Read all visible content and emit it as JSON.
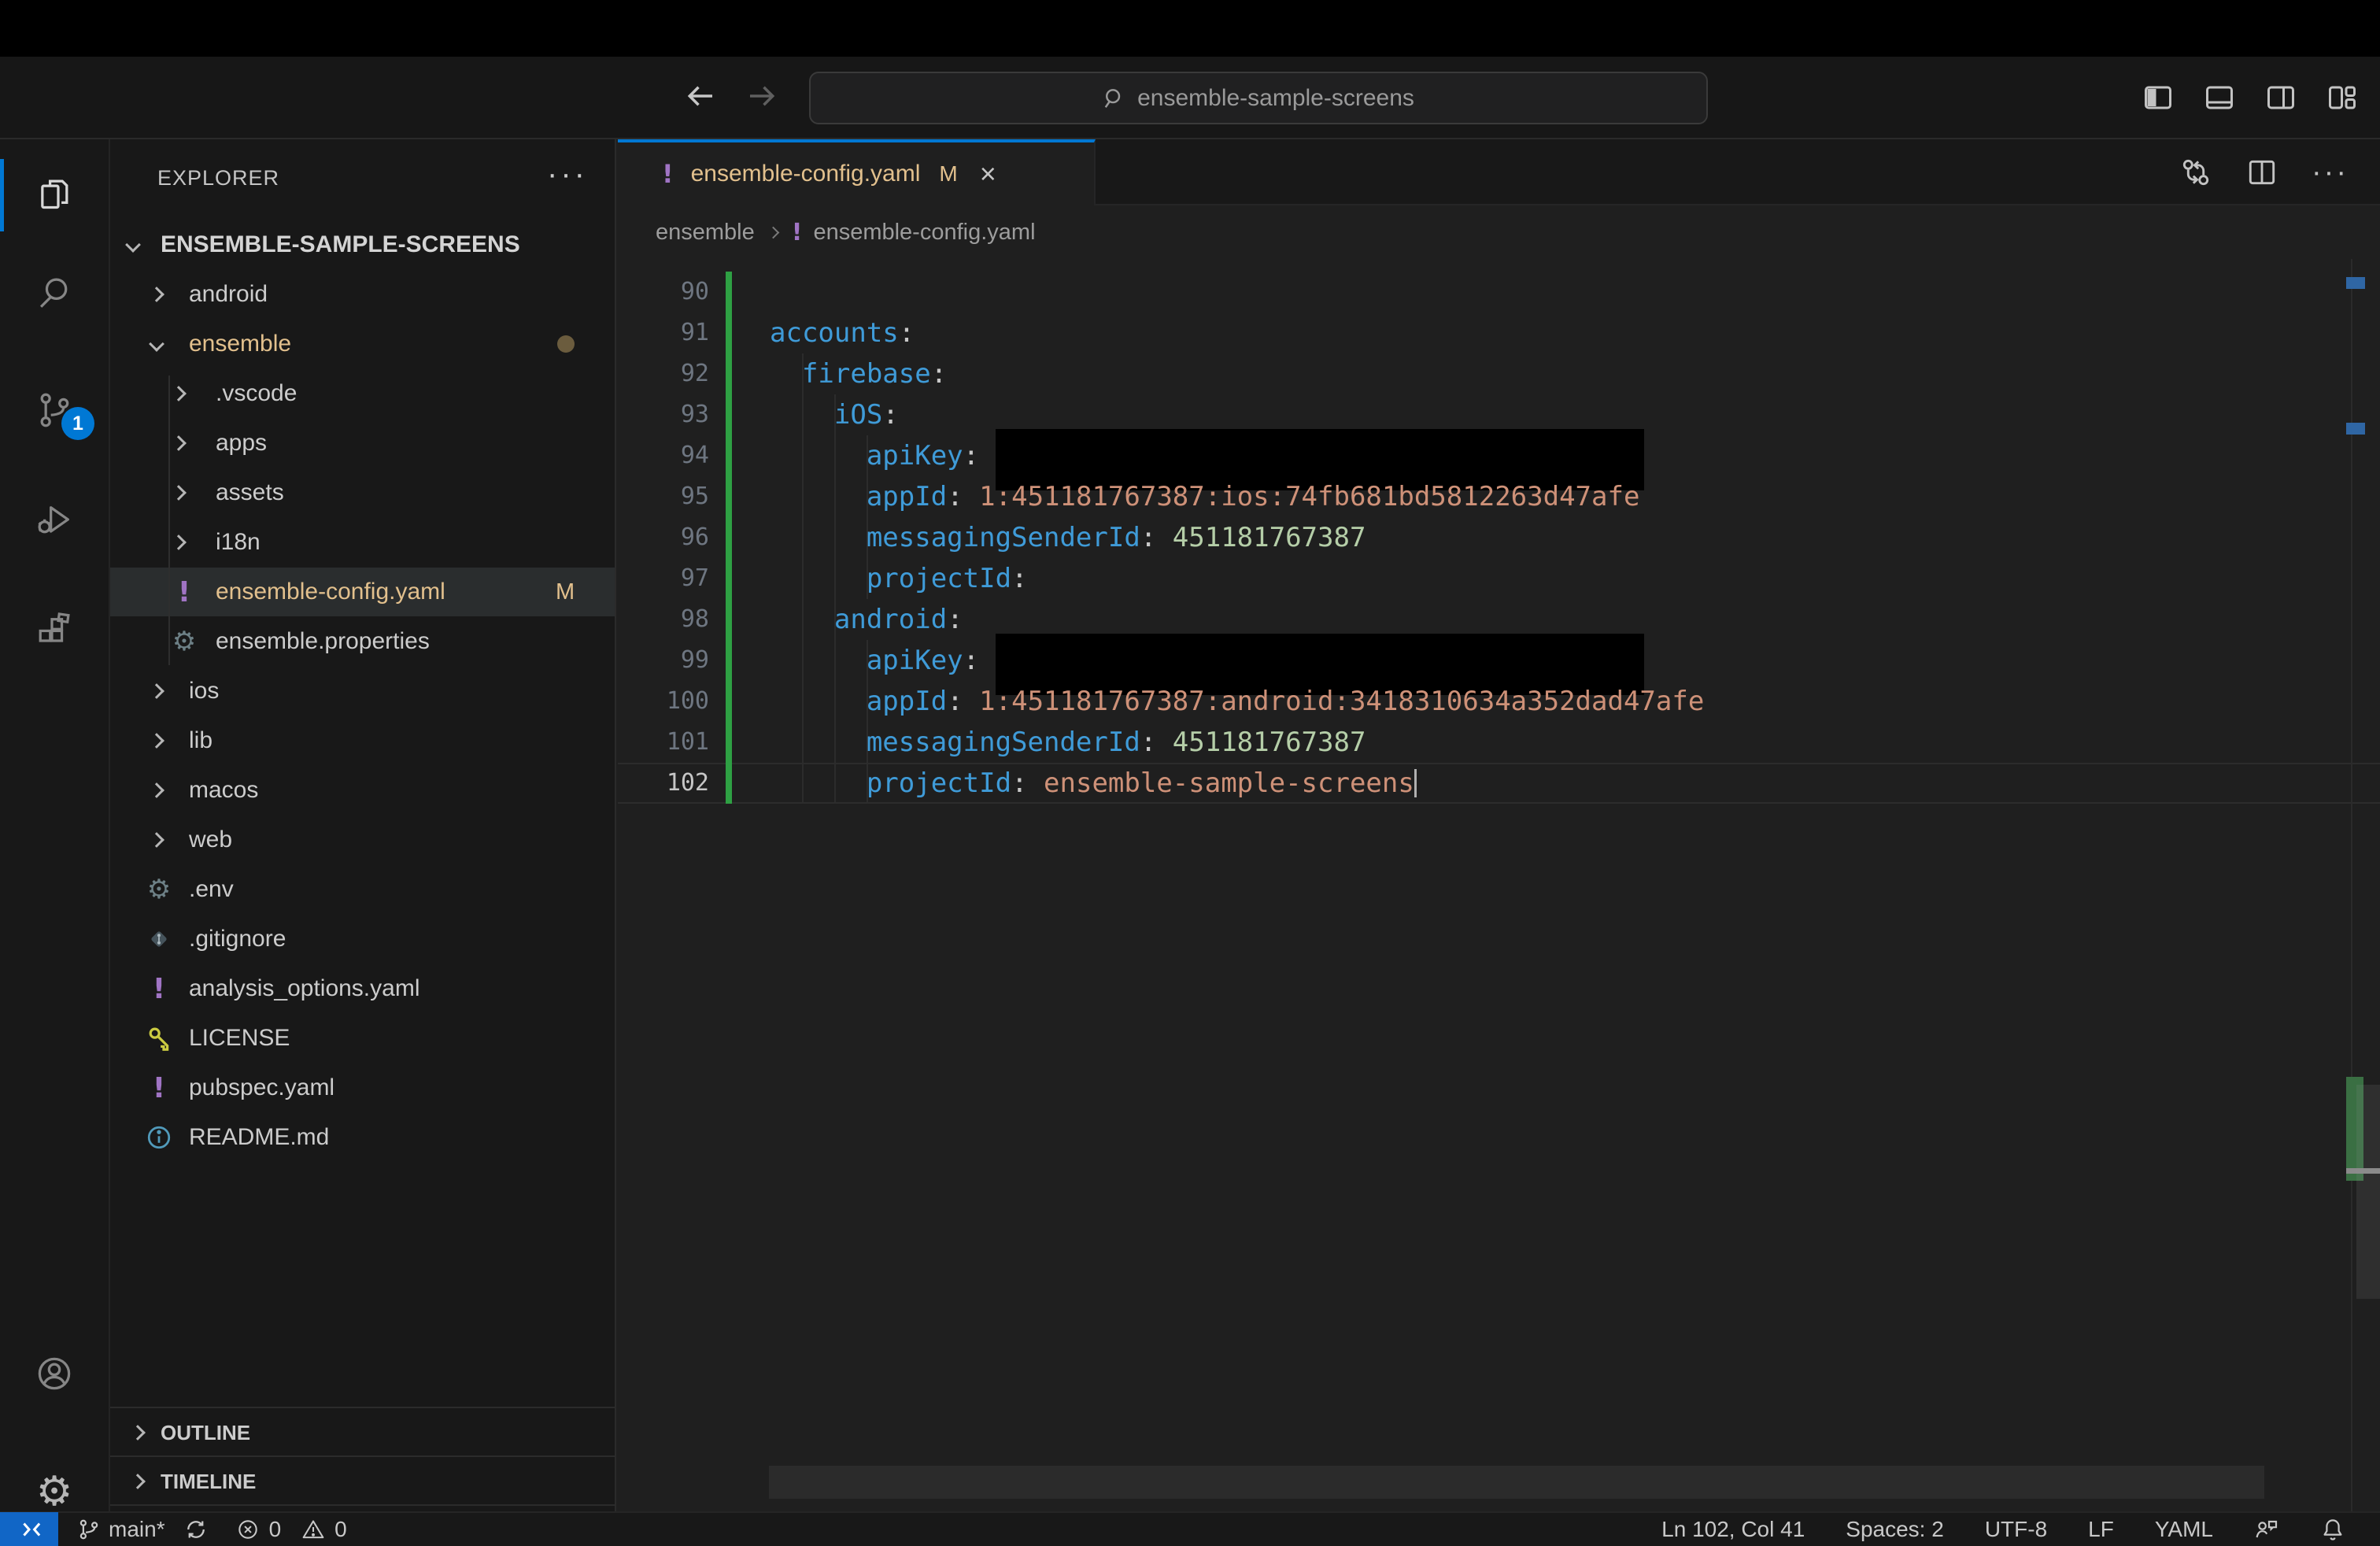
{
  "titlebar": {
    "search_text": "ensemble-sample-screens"
  },
  "activity_bar": {
    "scm_badge": "1"
  },
  "explorer": {
    "title": "EXPLORER",
    "root_label": "ENSEMBLE-SAMPLE-SCREENS",
    "items": [
      {
        "label": "android",
        "level": 1,
        "kind": "folder",
        "expanded": false
      },
      {
        "label": "ensemble",
        "level": 1,
        "kind": "folder",
        "expanded": true,
        "modified": true,
        "dot": true
      },
      {
        "label": ".vscode",
        "level": 2,
        "kind": "folder",
        "expanded": false
      },
      {
        "label": "apps",
        "level": 2,
        "kind": "folder",
        "expanded": false
      },
      {
        "label": "assets",
        "level": 2,
        "kind": "folder",
        "expanded": false
      },
      {
        "label": "i18n",
        "level": 2,
        "kind": "folder",
        "expanded": false
      },
      {
        "label": "ensemble-config.yaml",
        "level": 2,
        "kind": "file",
        "icon": "yaml",
        "modified": true,
        "selected": true,
        "badge": "M"
      },
      {
        "label": "ensemble.properties",
        "level": 2,
        "kind": "file",
        "icon": "gear"
      },
      {
        "label": "ios",
        "level": 1,
        "kind": "folder",
        "expanded": false
      },
      {
        "label": "lib",
        "level": 1,
        "kind": "folder",
        "expanded": false
      },
      {
        "label": "macos",
        "level": 1,
        "kind": "folder",
        "expanded": false
      },
      {
        "label": "web",
        "level": 1,
        "kind": "folder",
        "expanded": false
      },
      {
        "label": ".env",
        "level": 1,
        "kind": "file",
        "icon": "gear"
      },
      {
        "label": ".gitignore",
        "level": 1,
        "kind": "file",
        "icon": "git"
      },
      {
        "label": "analysis_options.yaml",
        "level": 1,
        "kind": "file",
        "icon": "yaml"
      },
      {
        "label": "LICENSE",
        "level": 1,
        "kind": "file",
        "icon": "key"
      },
      {
        "label": "pubspec.yaml",
        "level": 1,
        "kind": "file",
        "icon": "yaml"
      },
      {
        "label": "README.md",
        "level": 1,
        "kind": "file",
        "icon": "info"
      }
    ],
    "sections": {
      "outline": "OUTLINE",
      "timeline": "TIMELINE"
    }
  },
  "tabs": {
    "active": {
      "label": "ensemble-config.yaml",
      "badge": "M"
    }
  },
  "breadcrumbs": [
    {
      "label": "ensemble",
      "icon": null
    },
    {
      "label": "ensemble-config.yaml",
      "icon": "yaml"
    }
  ],
  "editor": {
    "lines": [
      {
        "n": "90",
        "segs": [],
        "mod": true
      },
      {
        "n": "91",
        "segs": [
          [
            "k",
            "accounts"
          ],
          [
            "p",
            ":"
          ]
        ],
        "mod": true
      },
      {
        "n": "92",
        "segs": [
          [
            "w",
            "  "
          ],
          [
            "k",
            "firebase"
          ],
          [
            "p",
            ":"
          ]
        ],
        "mod": true
      },
      {
        "n": "93",
        "segs": [
          [
            "w",
            "    "
          ],
          [
            "k",
            "iOS"
          ],
          [
            "p",
            ":"
          ]
        ],
        "mod": true
      },
      {
        "n": "94",
        "segs": [
          [
            "w",
            "      "
          ],
          [
            "k",
            "apiKey"
          ],
          [
            "p",
            ":"
          ]
        ],
        "mod": true,
        "redacted": true
      },
      {
        "n": "95",
        "segs": [
          [
            "w",
            "      "
          ],
          [
            "k",
            "appId"
          ],
          [
            "p",
            ":"
          ],
          [
            "w",
            " "
          ],
          [
            "s",
            "1:451181767387:ios:74fb681bd5812263d47afe"
          ]
        ],
        "mod": true
      },
      {
        "n": "96",
        "segs": [
          [
            "w",
            "      "
          ],
          [
            "k",
            "messagingSenderId"
          ],
          [
            "p",
            ":"
          ],
          [
            "w",
            " "
          ],
          [
            "num",
            "451181767387"
          ]
        ],
        "mod": true
      },
      {
        "n": "97",
        "segs": [
          [
            "w",
            "      "
          ],
          [
            "k",
            "projectId"
          ],
          [
            "p",
            ":"
          ]
        ],
        "mod": true
      },
      {
        "n": "98",
        "segs": [
          [
            "w",
            "    "
          ],
          [
            "k",
            "android"
          ],
          [
            "p",
            ":"
          ]
        ],
        "mod": true
      },
      {
        "n": "99",
        "segs": [
          [
            "w",
            "      "
          ],
          [
            "k",
            "apiKey"
          ],
          [
            "p",
            ":"
          ]
        ],
        "mod": true,
        "redacted": true
      },
      {
        "n": "100",
        "segs": [
          [
            "w",
            "      "
          ],
          [
            "k",
            "appId"
          ],
          [
            "p",
            ":"
          ],
          [
            "w",
            " "
          ],
          [
            "s",
            "1:451181767387:android:3418310634a352dad47afe"
          ]
        ],
        "mod": true
      },
      {
        "n": "101",
        "segs": [
          [
            "w",
            "      "
          ],
          [
            "k",
            "messagingSenderId"
          ],
          [
            "p",
            ":"
          ],
          [
            "w",
            " "
          ],
          [
            "num",
            "451181767387"
          ]
        ],
        "mod": true
      },
      {
        "n": "102",
        "segs": [
          [
            "w",
            "      "
          ],
          [
            "k",
            "projectId"
          ],
          [
            "p",
            ":"
          ],
          [
            "w",
            " "
          ],
          [
            "s",
            "ensemble-sample-screens"
          ]
        ],
        "mod": true,
        "current": true,
        "cursor": true
      }
    ]
  },
  "statusbar": {
    "left": [
      {
        "icon": "branch",
        "label": "main*",
        "name": "git-branch-status"
      },
      {
        "icon": "sync",
        "label": "",
        "name": "sync-status"
      }
    ],
    "problems": {
      "errors": "0",
      "warnings": "0"
    },
    "right": [
      {
        "label": "Ln 102, Col 41",
        "name": "cursor-position"
      },
      {
        "label": "Spaces: 2",
        "name": "indentation"
      },
      {
        "label": "UTF-8",
        "name": "encoding"
      },
      {
        "label": "LF",
        "name": "eol"
      },
      {
        "label": "YAML",
        "name": "language-mode"
      },
      {
        "icon": "feedback",
        "label": "",
        "name": "feedback"
      },
      {
        "icon": "bell",
        "label": "",
        "name": "notifications"
      }
    ]
  },
  "colors": {
    "accent_blue": "#0078d4",
    "remote_blue": "#1166c6",
    "git_modified": "#e2c08d",
    "yaml_icon_purple": "#a074c4",
    "key_blue": "#3f9bd8",
    "string_orange": "#ce9178",
    "number_green": "#b5cea8",
    "gutter_modified_green": "#2ea043",
    "editor_bg": "#1f1f1f",
    "chrome_bg": "#181818"
  }
}
